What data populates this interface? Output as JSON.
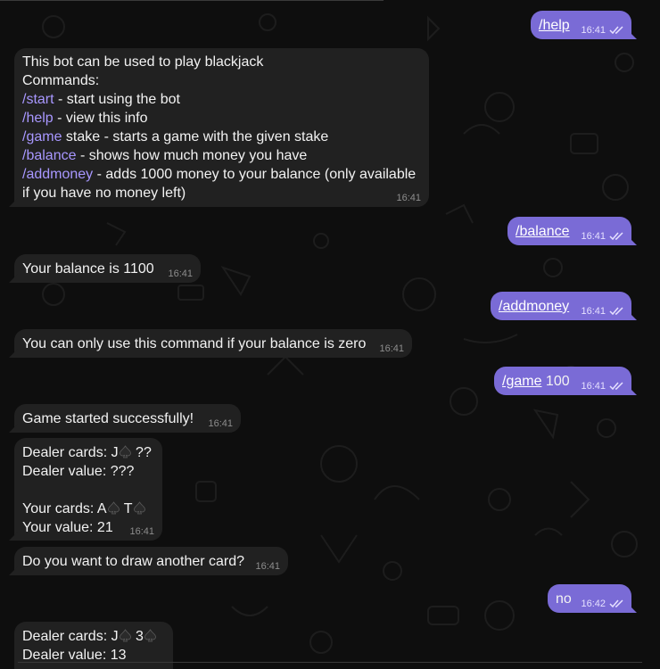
{
  "messages": {
    "m1": {
      "text": "/help",
      "time": "16:41"
    },
    "m2": {
      "l1": "This bot can be used to play blackjack",
      "l2": "Commands:",
      "l3_cmd": "/start",
      "l3_txt": " - start using the bot",
      "l4_cmd": "/help",
      "l4_txt": " - view this info",
      "l5_cmd": "/game",
      "l5_txt": " stake - starts a game with the given stake",
      "l6_cmd": "/balance",
      "l6_txt": " - shows how much money you have",
      "l7_cmd": "/addmoney",
      "l7_txt": " - adds 1000 money to your balance (only available",
      "l8": "if you have no money left)",
      "time": "16:41"
    },
    "m3": {
      "text": "/balance",
      "time": "16:41"
    },
    "m4": {
      "text": "Your balance is 1100",
      "time": "16:41"
    },
    "m5": {
      "text": "/addmoney",
      "time": "16:41"
    },
    "m6": {
      "text": "You can only use this command if your balance is zero",
      "time": "16:41"
    },
    "m7": {
      "cmd": "/game",
      "arg": " 100",
      "time": "16:41"
    },
    "m8": {
      "text": "Game started successfully!",
      "time": "16:41"
    },
    "m9": {
      "dealer_prefix": "Dealer cards: J",
      "dealer_hidden": " ??",
      "dealer_value": "Dealer value: ???",
      "your_prefix": "Your cards: A",
      "your_second": " T",
      "your_value": "Your value: 21",
      "time": "16:41"
    },
    "m10": {
      "text": "Do you want to draw another card?",
      "time": "16:41"
    },
    "m11": {
      "text": "no",
      "time": "16:42"
    },
    "m12": {
      "dealer_prefix": "Dealer cards: J",
      "dealer_second": " 3",
      "dealer_value": "Dealer value: 13"
    }
  },
  "icons": {
    "read_receipt": "double-check-icon",
    "suit": "spade-icon"
  },
  "colors": {
    "outgoing": "#7a6bd6",
    "incoming": "#212121",
    "command": "#a897ff",
    "background": "#0e0e0e"
  }
}
